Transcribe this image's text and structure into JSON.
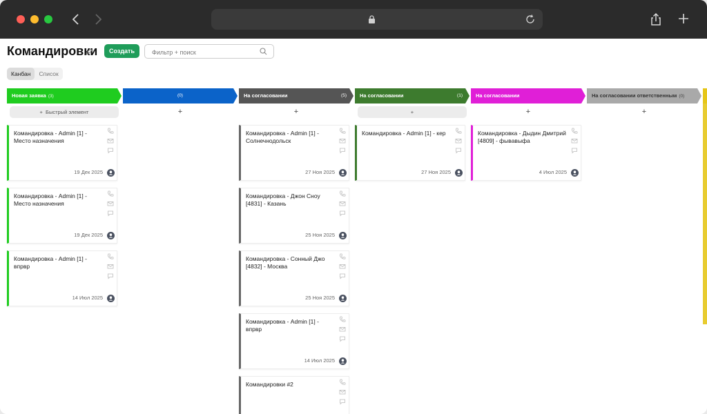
{
  "page": {
    "title": "Командировки",
    "create_label": "Создать",
    "search_placeholder": "Фильтр + поиск",
    "view_tabs": [
      "Канбан",
      "Список"
    ]
  },
  "colors": {
    "new": "#1fcc1f",
    "blue": "#0b63c9",
    "dark": "#555555",
    "green_dark": "#3d7b2e",
    "magenta": "#e01fd7",
    "gray": "#a9a9a9",
    "yellow": "#e6c619",
    "create": "#1f9d5a"
  },
  "columns": [
    {
      "title": "Новая заявка",
      "count": "(3)",
      "quick_add": "Быстрый элемент",
      "cards": [
        {
          "title": "Командировка - Admin [1] - Место назначения",
          "date": "19 Дек 2025"
        },
        {
          "title": "Командировка - Admin [1] - Место назначения",
          "date": "19 Дек 2025"
        },
        {
          "title": "Командировка - Admin [1] - впрвр",
          "date": "14 Июл 2025"
        }
      ]
    },
    {
      "title": "",
      "count": "(0)",
      "add": "+",
      "cards": []
    },
    {
      "title": "На согласовании",
      "count": "(5)",
      "add": "+",
      "cards": [
        {
          "title": "Командировка - Admin [1] - Солнечнодольск",
          "date": "27 Ноя 2025"
        },
        {
          "title": "Командировка - Джон Сноу [4831] - Казань",
          "date": "25 Ноя 2025"
        },
        {
          "title": "Командировка - Сонный Джо [4832] - Москва",
          "date": "25 Ноя 2025"
        },
        {
          "title": "Командировка - Admin [1] - впрвр",
          "date": "14 Июл 2025"
        },
        {
          "title": "Командировки #2",
          "date": ""
        }
      ]
    },
    {
      "title": "На согласовании",
      "count": "(1)",
      "add": "+",
      "cards": [
        {
          "title": "Командировка - Admin [1] - кер",
          "date": "27 Ноя 2025"
        }
      ]
    },
    {
      "title": "На согласовании",
      "count": "",
      "add": "+",
      "cards": [
        {
          "title": "Командировка - Дыдин Дмитрий [4809] - фывавыфа",
          "date": "4 Июл 2025"
        }
      ]
    },
    {
      "title": "На согласовании ответственным",
      "count": "(0)",
      "add": "+",
      "cards": []
    }
  ]
}
